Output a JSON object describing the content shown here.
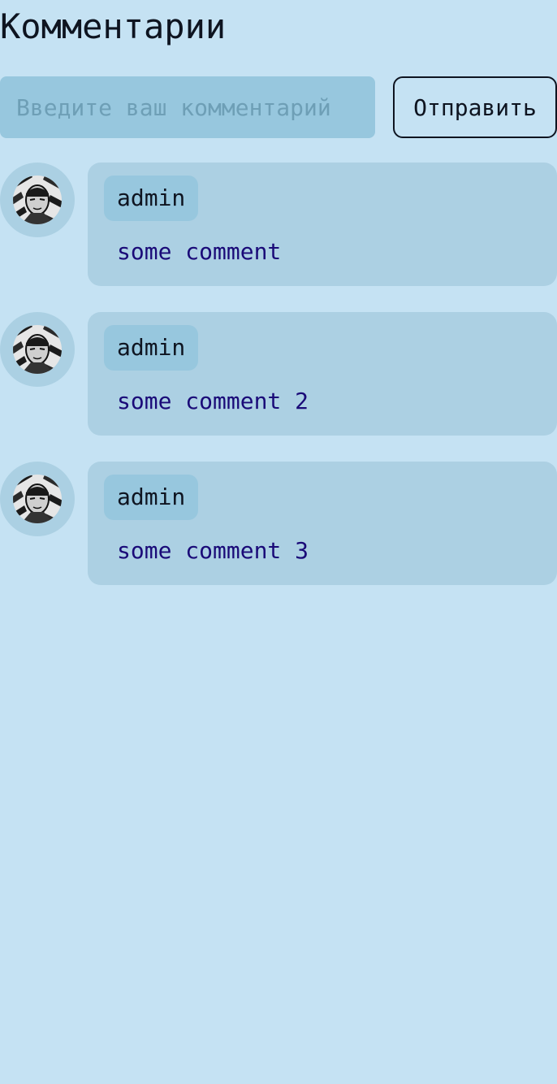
{
  "header": {
    "title": "Комментарии"
  },
  "form": {
    "placeholder": "Введите ваш комментарий",
    "value": "",
    "submit_label": "Отправить"
  },
  "comments": [
    {
      "author": "admin",
      "text": "some comment",
      "avatar_icon": "user-avatar-icon"
    },
    {
      "author": "admin",
      "text": "some comment 2",
      "avatar_icon": "user-avatar-icon"
    },
    {
      "author": "admin",
      "text": "some comment 3",
      "avatar_icon": "user-avatar-icon"
    }
  ],
  "colors": {
    "background": "#c5e2f3",
    "input_bg": "#97c7de",
    "card_bg": "#acd0e3",
    "comment_text": "#1a0a78",
    "text": "#0e1420"
  }
}
